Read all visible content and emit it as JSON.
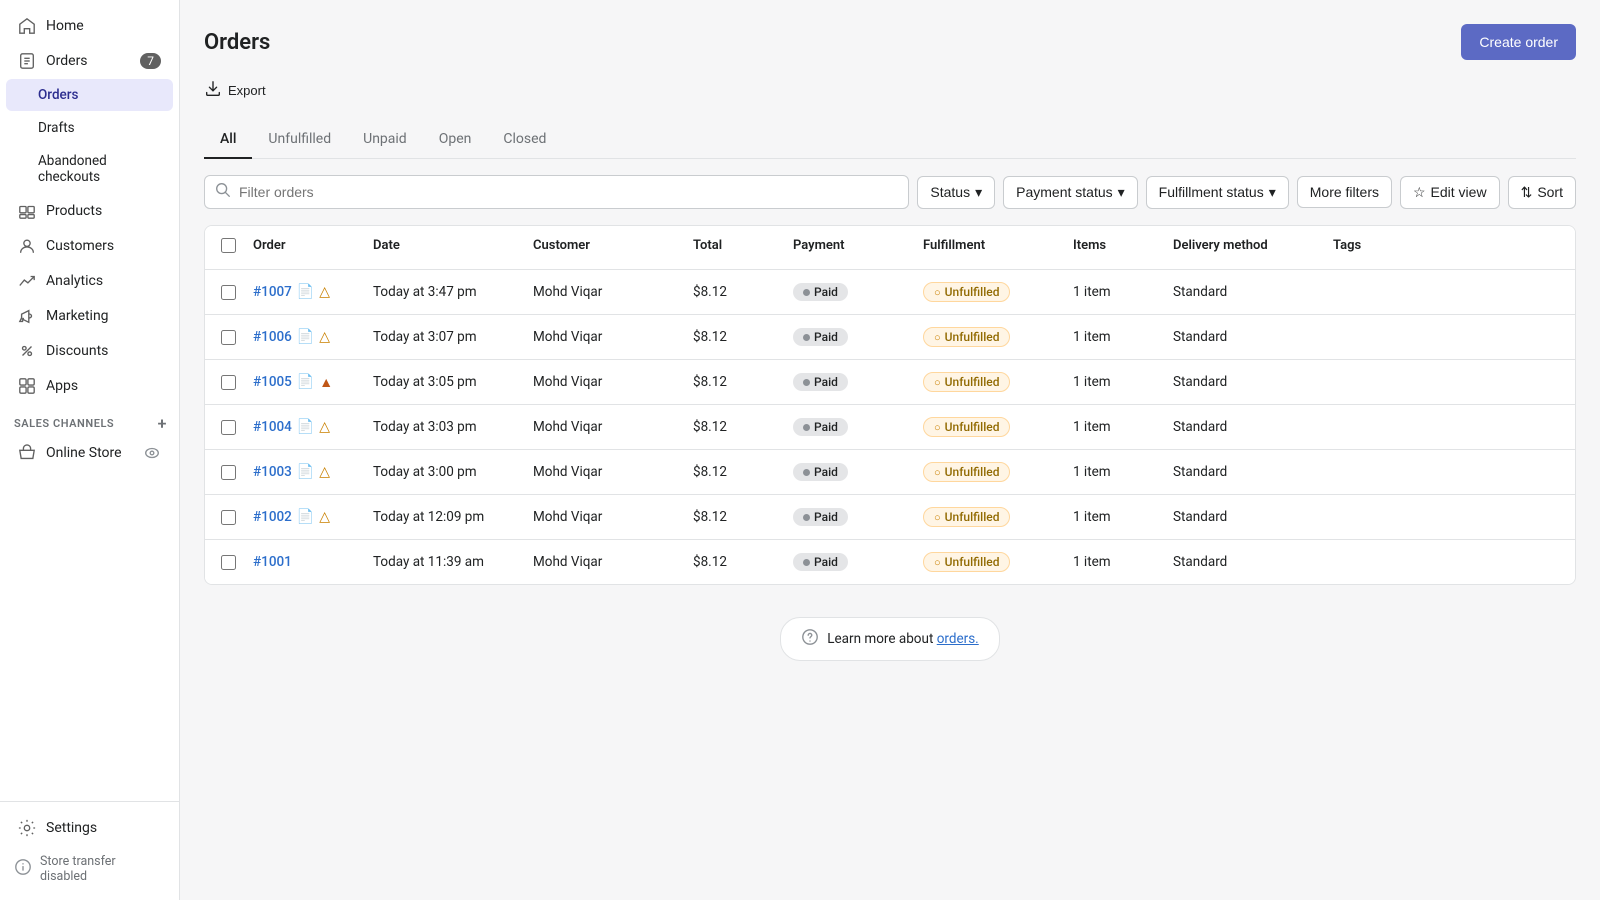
{
  "sidebar": {
    "items": [
      {
        "id": "home",
        "label": "Home",
        "icon": "home"
      },
      {
        "id": "orders",
        "label": "Orders",
        "icon": "orders",
        "badge": "7"
      },
      {
        "id": "orders-sub-orders",
        "label": "Orders",
        "sub": true,
        "active": true
      },
      {
        "id": "orders-sub-drafts",
        "label": "Drafts",
        "sub": true
      },
      {
        "id": "orders-sub-abandoned",
        "label": "Abandoned checkouts",
        "sub": true
      },
      {
        "id": "products",
        "label": "Products",
        "icon": "products"
      },
      {
        "id": "customers",
        "label": "Customers",
        "icon": "customers"
      },
      {
        "id": "analytics",
        "label": "Analytics",
        "icon": "analytics"
      },
      {
        "id": "marketing",
        "label": "Marketing",
        "icon": "marketing"
      },
      {
        "id": "discounts",
        "label": "Discounts",
        "icon": "discounts"
      },
      {
        "id": "apps",
        "label": "Apps",
        "icon": "apps"
      }
    ],
    "sales_channels_label": "SALES CHANNELS",
    "online_store_label": "Online Store",
    "settings_label": "Settings",
    "store_transfer_label": "Store transfer disabled"
  },
  "page": {
    "title": "Orders",
    "export_label": "Export",
    "create_order_label": "Create order"
  },
  "tabs": [
    {
      "id": "all",
      "label": "All",
      "active": true
    },
    {
      "id": "unfulfilled",
      "label": "Unfulfilled"
    },
    {
      "id": "unpaid",
      "label": "Unpaid"
    },
    {
      "id": "open",
      "label": "Open"
    },
    {
      "id": "closed",
      "label": "Closed"
    }
  ],
  "filters": {
    "search_placeholder": "Filter orders",
    "status_label": "Status",
    "payment_status_label": "Payment status",
    "fulfillment_status_label": "Fulfillment status",
    "more_filters_label": "More filters",
    "edit_view_label": "Edit view",
    "sort_label": "Sort"
  },
  "table": {
    "columns": [
      "",
      "Order",
      "Date",
      "Customer",
      "Total",
      "Payment",
      "Fulfillment",
      "Items",
      "Delivery method",
      "Tags"
    ],
    "rows": [
      {
        "id": "#1007",
        "date": "Today at 3:47 pm",
        "customer": "Mohd Viqar",
        "total": "$8.12",
        "payment": "Paid",
        "fulfillment": "Unfulfilled",
        "items": "1 item",
        "delivery": "Standard",
        "has_doc": true,
        "has_warning": true,
        "warning_red": false
      },
      {
        "id": "#1006",
        "date": "Today at 3:07 pm",
        "customer": "Mohd Viqar",
        "total": "$8.12",
        "payment": "Paid",
        "fulfillment": "Unfulfilled",
        "items": "1 item",
        "delivery": "Standard",
        "has_doc": true,
        "has_warning": true,
        "warning_red": false
      },
      {
        "id": "#1005",
        "date": "Today at 3:05 pm",
        "customer": "Mohd Viqar",
        "total": "$8.12",
        "payment": "Paid",
        "fulfillment": "Unfulfilled",
        "items": "1 item",
        "delivery": "Standard",
        "has_doc": true,
        "has_warning": true,
        "warning_red": true
      },
      {
        "id": "#1004",
        "date": "Today at 3:03 pm",
        "customer": "Mohd Viqar",
        "total": "$8.12",
        "payment": "Paid",
        "fulfillment": "Unfulfilled",
        "items": "1 item",
        "delivery": "Standard",
        "has_doc": true,
        "has_warning": true,
        "warning_red": false
      },
      {
        "id": "#1003",
        "date": "Today at 3:00 pm",
        "customer": "Mohd Viqar",
        "total": "$8.12",
        "payment": "Paid",
        "fulfillment": "Unfulfilled",
        "items": "1 item",
        "delivery": "Standard",
        "has_doc": true,
        "has_warning": true,
        "warning_red": false
      },
      {
        "id": "#1002",
        "date": "Today at 12:09 pm",
        "customer": "Mohd Viqar",
        "total": "$8.12",
        "payment": "Paid",
        "fulfillment": "Unfulfilled",
        "items": "1 item",
        "delivery": "Standard",
        "has_doc": true,
        "has_warning": true,
        "warning_red": false
      },
      {
        "id": "#1001",
        "date": "Today at 11:39 am",
        "customer": "Mohd Viqar",
        "total": "$8.12",
        "payment": "Paid",
        "fulfillment": "Unfulfilled",
        "items": "1 item",
        "delivery": "Standard",
        "has_doc": false,
        "has_warning": false,
        "warning_red": false
      }
    ]
  },
  "learn_more": {
    "text": "Learn more about ",
    "link_label": "orders.",
    "link_href": "#"
  }
}
